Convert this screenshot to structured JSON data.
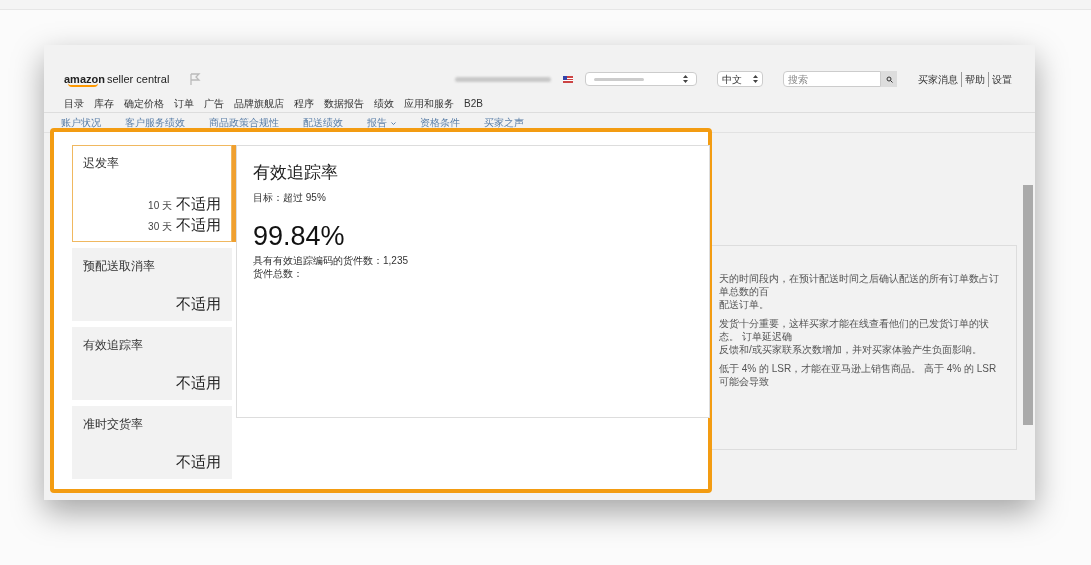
{
  "header": {
    "logo_bold": "amazon",
    "logo_rest": "seller central",
    "language": "中文",
    "search_placeholder": "搜索",
    "links": [
      "买家消息",
      "帮助",
      "设置"
    ]
  },
  "nav": [
    "目录",
    "库存",
    "确定价格",
    "订单",
    "广告",
    "品牌旗舰店",
    "程序",
    "数据报告",
    "绩效",
    "应用和服务",
    "B2B"
  ],
  "subnav": [
    {
      "label": "账户状况",
      "dropdown": false
    },
    {
      "label": "客户服务绩效",
      "dropdown": false
    },
    {
      "label": "商品政策合规性",
      "dropdown": false
    },
    {
      "label": "配送绩效",
      "dropdown": false
    },
    {
      "label": "报告",
      "dropdown": true
    },
    {
      "label": "资格条件",
      "dropdown": false
    },
    {
      "label": "买家之声",
      "dropdown": false
    }
  ],
  "background_text": [
    "天的时间段内，在预计配送时间之后确认配送的所有订单数占订单总数的百",
    "配送订单。",
    "发货十分重要，这样买家才能在线查看他们的已发货订单的状态。 订单延迟确",
    "反馈和/或买家联系次数增加，并对买家体验产生负面影响。",
    "低于 4% 的 LSR，才能在亚马逊上销售商品。 高于 4% 的 LSR 可能会导致"
  ],
  "metric_cards": [
    {
      "title": "迟发率",
      "selected": true,
      "values": [
        {
          "period": "10 天",
          "value": "不适用"
        },
        {
          "period": "30 天",
          "value": "不适用"
        }
      ]
    },
    {
      "title": "预配送取消率",
      "selected": false,
      "values": [
        {
          "value": "不适用"
        }
      ]
    },
    {
      "title": "有效追踪率",
      "selected": false,
      "values": [
        {
          "value": "不适用"
        }
      ]
    },
    {
      "title": "准时交货率",
      "selected": false,
      "values": [
        {
          "value": "不适用"
        }
      ]
    }
  ],
  "detail": {
    "title": "有效追踪率",
    "target": "目标：超过 95%",
    "value": "99.84%",
    "lines": [
      "具有有效追踪编码的货件数：1,235",
      "货件总数："
    ]
  }
}
